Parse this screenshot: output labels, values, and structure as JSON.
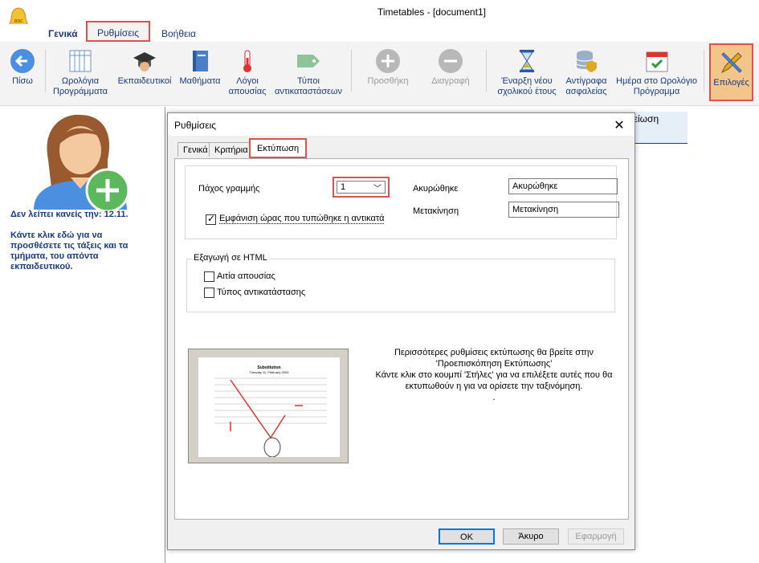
{
  "window": {
    "title": "Timetables - [document1]"
  },
  "menu": {
    "general": "Γενικά",
    "settings": "Ρυθμίσεις",
    "help": "Βοήθεια"
  },
  "ribbon": {
    "back": "Πίσω",
    "timetables_l1": "Ωρολόγια",
    "timetables_l2": "Προγράμματα",
    "teachers": "Εκπαιδευτικοί",
    "subjects": "Μαθήματα",
    "absence_l1": "Λόγοι",
    "absence_l2": "απουσίας",
    "subst_l1": "Τύποι",
    "subst_l2": "αντικαταστάσεων",
    "add": "Προσθήκη",
    "delete": "Διαγραφή",
    "newyear_l1": "Έναρξη νέου",
    "newyear_l2": "σχολικού έτους",
    "backup_l1": "Αντίγραφα",
    "backup_l2": "ασφαλείας",
    "daytt_l1": "Ημέρα στο Ωρολόγιο",
    "daytt_l2": "Πρόγραμμα",
    "options": "Επιλογές"
  },
  "left_panel": {
    "missing": "Δεν λείπει κανείς την: 12.11.",
    "click_here": "Κάντε κλικ εδώ για να προσθέσετε τις τάξεις και τα τμήματα, του απόντα εκπαιδευτικού."
  },
  "background": {
    "header_fragment": "ιείωση"
  },
  "dialog": {
    "title": "Ρυθμίσεις",
    "close": "✕",
    "tabs": {
      "general": "Γενικά",
      "criteria": "Κριτήρια",
      "printing": "Εκτύπωση"
    },
    "line_width_label": "Πάχος γραμμής",
    "line_width_value": "1",
    "show_time_label": "Εμφάνιση ώρας που τυπώθηκε η αντικατά",
    "cancelled_label": "Ακυρώθηκε",
    "cancelled_value": "Ακυρώθηκε",
    "move_label": "Μετακίνηση",
    "move_value": "Μετακίνηση",
    "html_group_title": "Εξαγωγή σε HTML",
    "absence_reason": "Αιτία απουσίας",
    "substitution_type": "Τύπος αντικατάστασης",
    "info_l1": "Περισσότερες ρυθμίσεις εκτύπωσης θα βρείτε στην",
    "info_l2": "'Προεπισκόπηση Εκτύπωσης'",
    "info_l3": "Κάντε κλικ στο κουμπί 'Στήλες' για να επιλέξετε αυτές που θα",
    "info_l4": "εκτυπωθούν η για να ορίσετε την ταξινόμηση.",
    "info_l5": ".",
    "preview": {
      "doc_title": "Substitution",
      "doc_subtitle": "Tuesday 11. February 2003"
    },
    "buttons": {
      "ok": "OK",
      "cancel": "Άκυρο",
      "apply": "Εφαρμογή"
    }
  },
  "colors": {
    "accent_red": "#d9534f",
    "text_blue": "#1b3a7a",
    "options_bg": "#f3c58a"
  }
}
